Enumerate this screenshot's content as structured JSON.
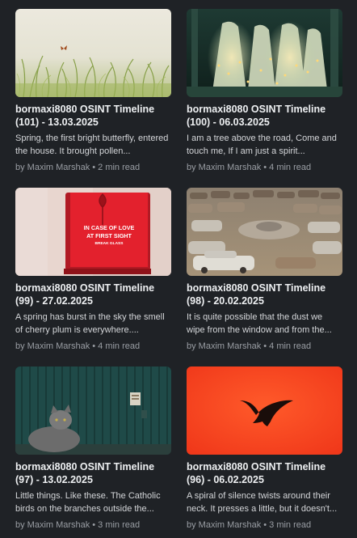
{
  "posts": [
    {
      "title": "bormaxi8080 OSINT Timeline (101) - 13.03.2025",
      "excerpt": "Spring, the first bright butterfly, entered the house. It brought pollen...",
      "author": "by Maxim Marshak",
      "read_time": "2 min read",
      "image": "butterfly-meadow-image"
    },
    {
      "title": "bormaxi8080 OSINT Timeline (100) - 06.03.2025",
      "excerpt": "I am a tree above the road, Come and touch me, If I am just a spirit...",
      "author": "by Maxim Marshak",
      "read_time": "4 min read",
      "image": "glowing-spirits-forest-image"
    },
    {
      "title": "bormaxi8080 OSINT Timeline (99) - 27.02.2025",
      "excerpt": "A spring has burst in the sky the smell of cherry plum is everywhere....",
      "author": "by Maxim Marshak",
      "read_time": "4 min read",
      "image": "break-glass-box-image",
      "image_text": [
        "IN CASE OF LOVE",
        "AT FIRST SIGHT",
        "BREAK GLASS"
      ]
    },
    {
      "title": "bormaxi8080 OSINT Timeline (98) - 20.02.2025",
      "excerpt": "It is quite possible that the dust we wipe from the window and from the...",
      "author": "by Maxim Marshak",
      "read_time": "4 min read",
      "image": "abandoned-cars-image"
    },
    {
      "title": "bormaxi8080 OSINT Timeline (97) - 13.02.2025",
      "excerpt": "Little things. Like these. The Catholic birds on the branches outside the...",
      "author": "by Maxim Marshak",
      "read_time": "3 min read",
      "image": "cat-by-wall-image"
    },
    {
      "title": "bormaxi8080 OSINT Timeline (96) - 06.02.2025",
      "excerpt": "A spiral of silence twists around their neck. It presses a little, but it doesn't...",
      "author": "by Maxim Marshak",
      "read_time": "3 min read",
      "image": "bird-silhouette-image"
    }
  ],
  "colors": {
    "background": "#1f2226",
    "title": "#eef0f2",
    "excerpt": "#d4d6d9",
    "meta": "#9a9ea4"
  }
}
